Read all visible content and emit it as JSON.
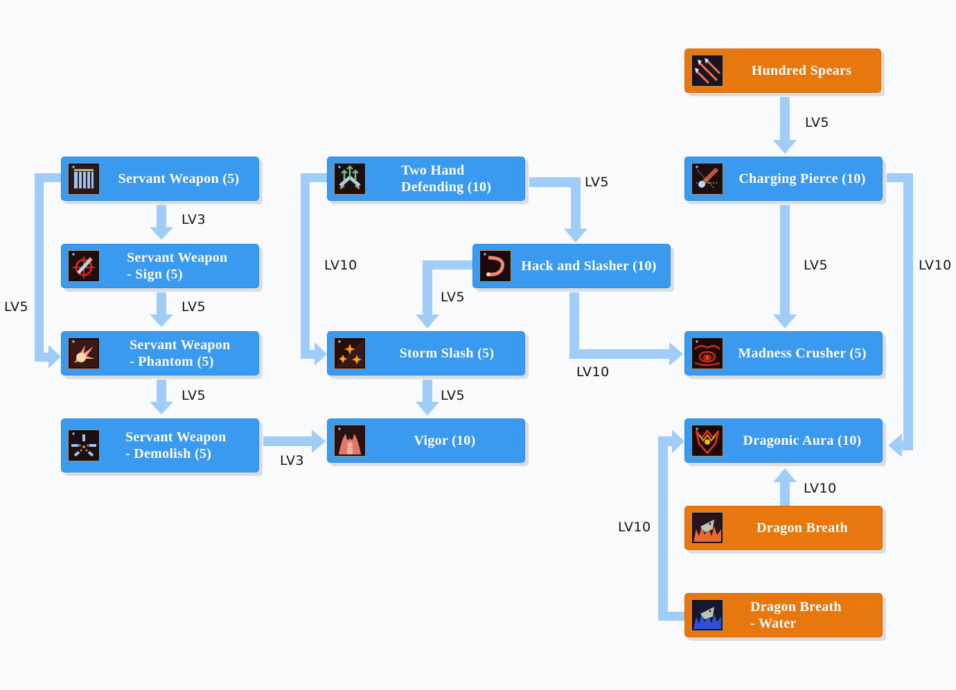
{
  "colors": {
    "skill_node": "#3a9af0",
    "prerequisite_node": "#e8780e",
    "arrow": "#9fcdf8",
    "background": "#f8fafc",
    "label_text": "#111111"
  },
  "nodes": {
    "servant_weapon": {
      "lines": [
        "Servant Weapon (5)"
      ],
      "icon": "servant-weapon-icon",
      "type": "skill"
    },
    "servant_weapon_sign": {
      "lines": [
        "Servant Weapon",
        "- Sign (5)"
      ],
      "icon": "servant-weapon-sign-icon",
      "type": "skill"
    },
    "servant_weapon_phantom": {
      "lines": [
        "Servant Weapon",
        "- Phantom (5)"
      ],
      "icon": "servant-weapon-phantom-icon",
      "type": "skill"
    },
    "servant_weapon_demolish": {
      "lines": [
        "Servant Weapon",
        "- Demolish (5)"
      ],
      "icon": "servant-weapon-demolish-icon",
      "type": "skill"
    },
    "two_hand_defending": {
      "lines": [
        "Two Hand",
        "Defending (10)"
      ],
      "icon": "two-hand-defending-icon",
      "type": "skill"
    },
    "hack_and_slasher": {
      "lines": [
        "Hack and Slasher (10)"
      ],
      "icon": "hack-and-slasher-icon",
      "type": "skill"
    },
    "storm_slash": {
      "lines": [
        "Storm Slash (5)"
      ],
      "icon": "storm-slash-icon",
      "type": "skill"
    },
    "vigor": {
      "lines": [
        "Vigor (10)"
      ],
      "icon": "vigor-icon",
      "type": "skill"
    },
    "hundred_spears": {
      "lines": [
        "Hundred Spears"
      ],
      "icon": "hundred-spears-icon",
      "type": "prerequisite"
    },
    "charging_pierce": {
      "lines": [
        "Charging Pierce (10)"
      ],
      "icon": "charging-pierce-icon",
      "type": "skill"
    },
    "madness_crusher": {
      "lines": [
        "Madness Crusher (5)"
      ],
      "icon": "madness-crusher-icon",
      "type": "skill"
    },
    "dragonic_aura": {
      "lines": [
        "Dragonic Aura (10)"
      ],
      "icon": "dragonic-aura-icon",
      "type": "skill"
    },
    "dragon_breath": {
      "lines": [
        "Dragon Breath"
      ],
      "icon": "dragon-breath-icon",
      "type": "prerequisite"
    },
    "dragon_breath_water": {
      "lines": [
        "Dragon Breath",
        "- Water"
      ],
      "icon": "dragon-breath-water-icon",
      "type": "prerequisite"
    }
  },
  "edges": [
    {
      "from": "servant_weapon",
      "to": "servant_weapon_sign",
      "label": "LV3"
    },
    {
      "from": "servant_weapon_sign",
      "to": "servant_weapon_phantom",
      "label": "LV5"
    },
    {
      "from": "servant_weapon",
      "to": "servant_weapon_phantom",
      "label": "LV5"
    },
    {
      "from": "servant_weapon_phantom",
      "to": "servant_weapon_demolish",
      "label": "LV5"
    },
    {
      "from": "servant_weapon_demolish",
      "to": "vigor",
      "label": "LV3"
    },
    {
      "from": "two_hand_defending",
      "to": "storm_slash",
      "label": "LV10"
    },
    {
      "from": "two_hand_defending",
      "to": "hack_and_slasher",
      "label": "LV5"
    },
    {
      "from": "hack_and_slasher",
      "to": "storm_slash",
      "label": "LV5"
    },
    {
      "from": "hack_and_slasher",
      "to": "madness_crusher",
      "label": "LV10"
    },
    {
      "from": "storm_slash",
      "to": "vigor",
      "label": "LV5"
    },
    {
      "from": "hundred_spears",
      "to": "charging_pierce",
      "label": "LV5"
    },
    {
      "from": "charging_pierce",
      "to": "madness_crusher",
      "label": "LV5"
    },
    {
      "from": "charging_pierce",
      "to": "dragonic_aura",
      "label": "LV10"
    },
    {
      "from": "dragon_breath",
      "to": "dragonic_aura",
      "label": "LV10"
    },
    {
      "from": "dragon_breath_water",
      "to": "dragonic_aura",
      "label": "LV10"
    }
  ]
}
